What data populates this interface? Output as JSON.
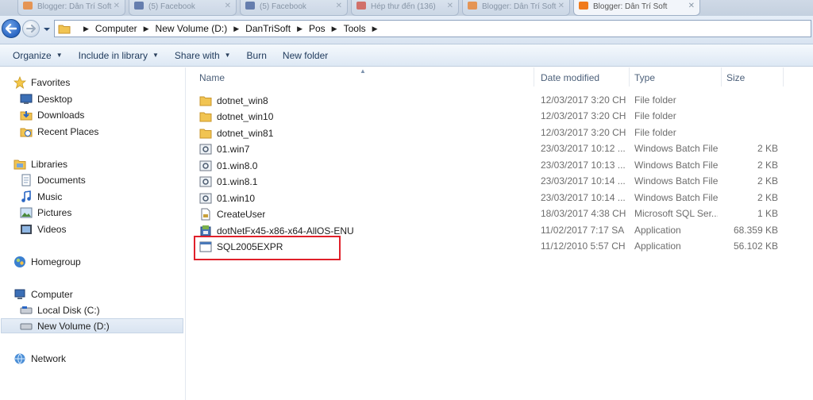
{
  "browser_tabs": [
    {
      "label": "Blogger: Dân Trí Soft"
    },
    {
      "label": "(5) Facebook"
    },
    {
      "label": "(5) Facebook"
    },
    {
      "label": "Hép thư đến (136)"
    },
    {
      "label": "Blogger: Dân Trí Soft"
    },
    {
      "label": "Blogger: Dân Trí Soft"
    }
  ],
  "address": {
    "crumbs": [
      "Computer",
      "New Volume (D:)",
      "DanTriSoft",
      "Pos",
      "Tools"
    ]
  },
  "toolbar": {
    "organize": "Organize",
    "include": "Include in library",
    "share": "Share with",
    "burn": "Burn",
    "new_folder": "New folder"
  },
  "nav": {
    "favorites": "Favorites",
    "desktop": "Desktop",
    "downloads": "Downloads",
    "recent": "Recent Places",
    "libraries": "Libraries",
    "documents": "Documents",
    "music": "Music",
    "pictures": "Pictures",
    "videos": "Videos",
    "homegroup": "Homegroup",
    "computer": "Computer",
    "local_disk": "Local Disk (C:)",
    "new_volume": "New Volume (D:)",
    "network": "Network"
  },
  "columns": {
    "name": "Name",
    "date": "Date modified",
    "type": "Type",
    "size": "Size"
  },
  "files": [
    {
      "name": "dotnet_win8",
      "date": "12/03/2017 3:20 CH",
      "type": "File folder",
      "size": "",
      "icon": "folder-icon"
    },
    {
      "name": "dotnet_win10",
      "date": "12/03/2017 3:20 CH",
      "type": "File folder",
      "size": "",
      "icon": "folder-icon"
    },
    {
      "name": "dotnet_win81",
      "date": "12/03/2017 3:20 CH",
      "type": "File folder",
      "size": "",
      "icon": "folder-icon"
    },
    {
      "name": "01.win7",
      "date": "23/03/2017 10:12 ...",
      "type": "Windows Batch File",
      "size": "2 KB",
      "icon": "batch-file-icon"
    },
    {
      "name": "01.win8.0",
      "date": "23/03/2017 10:13 ...",
      "type": "Windows Batch File",
      "size": "2 KB",
      "icon": "batch-file-icon"
    },
    {
      "name": "01.win8.1",
      "date": "23/03/2017 10:14 ...",
      "type": "Windows Batch File",
      "size": "2 KB",
      "icon": "batch-file-icon"
    },
    {
      "name": "01.win10",
      "date": "23/03/2017 10:14 ...",
      "type": "Windows Batch File",
      "size": "2 KB",
      "icon": "batch-file-icon"
    },
    {
      "name": "CreateUser",
      "date": "18/03/2017 4:38 CH",
      "type": "Microsoft SQL Ser...",
      "size": "1 KB",
      "icon": "sql-file-icon"
    },
    {
      "name": "dotNetFx45-x86-x64-AllOS-ENU",
      "date": "11/02/2017 7:17 SA",
      "type": "Application",
      "size": "68.359 KB",
      "icon": "installer-icon"
    },
    {
      "name": "SQL2005EXPR",
      "date": "11/12/2010 5:57 CH",
      "type": "Application",
      "size": "56.102 KB",
      "icon": "application-icon"
    }
  ],
  "colors": {
    "highlight": "#e0202a",
    "folder": "#f1c452",
    "toolbar_text": "#1e395b"
  }
}
